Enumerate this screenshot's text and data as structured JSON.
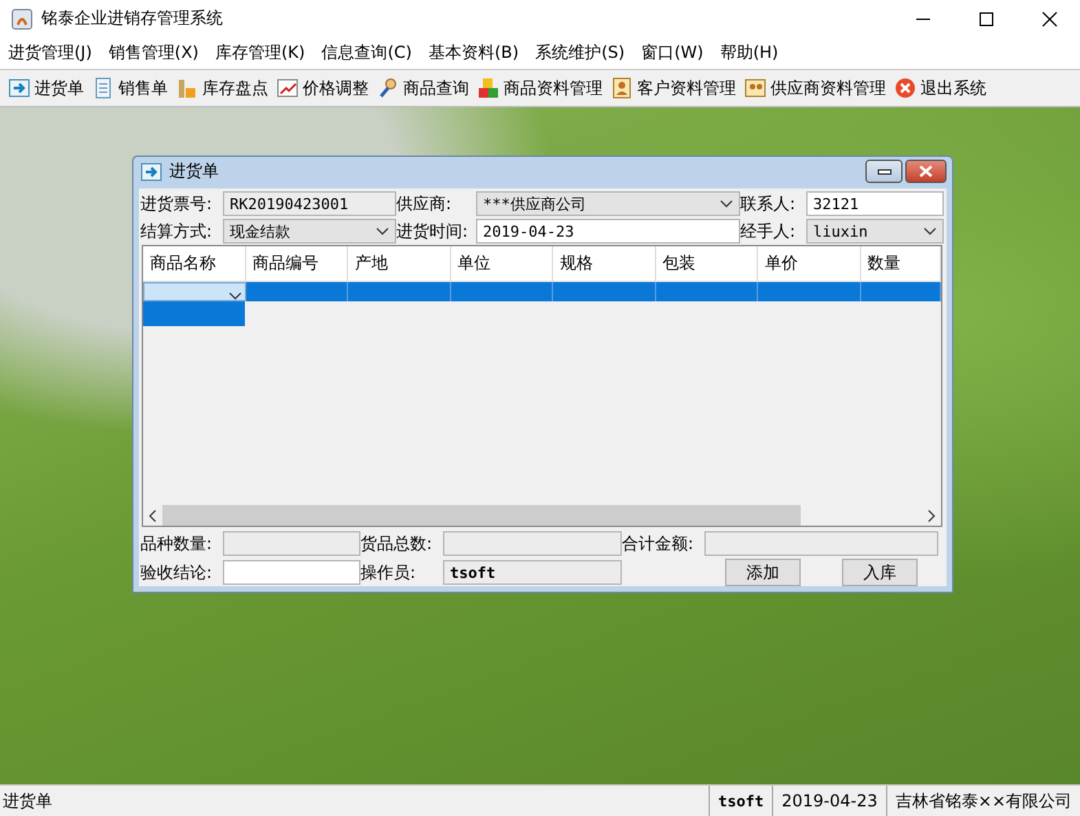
{
  "window": {
    "title": "铭泰企业进销存管理系统"
  },
  "menu": [
    {
      "label": "进货管理(J)"
    },
    {
      "label": "销售管理(X)"
    },
    {
      "label": "库存管理(K)"
    },
    {
      "label": "信息查询(C)"
    },
    {
      "label": "基本资料(B)"
    },
    {
      "label": "系统维护(S)"
    },
    {
      "label": "窗口(W)"
    },
    {
      "label": "帮助(H)"
    }
  ],
  "toolbar": [
    {
      "label": "进货单"
    },
    {
      "label": "销售单"
    },
    {
      "label": "库存盘点"
    },
    {
      "label": "价格调整"
    },
    {
      "label": "商品查询"
    },
    {
      "label": "商品资料管理"
    },
    {
      "label": "客户资料管理"
    },
    {
      "label": "供应商资料管理"
    },
    {
      "label": "退出系统"
    }
  ],
  "dialog": {
    "title": "进货单",
    "fields": [
      {
        "label": "进货票号:",
        "value": "RK20190423001",
        "kind": "readonly"
      },
      {
        "label": "供应商:",
        "value": "***供应商公司",
        "kind": "combo"
      },
      {
        "label": "联系人:",
        "value": "32121",
        "kind": "text"
      },
      {
        "label": "结算方式:",
        "value": "现金结款",
        "kind": "combo"
      },
      {
        "label": "进货时间:",
        "value": "2019-04-23",
        "kind": "text"
      },
      {
        "label": "经手人:",
        "value": "liuxin",
        "kind": "combo"
      }
    ],
    "table": {
      "columns": [
        "商品名称",
        "商品编号",
        "产地",
        "单位",
        "规格",
        "包装",
        "单价",
        "数量"
      ],
      "rows": [
        {
          "selected": true,
          "editing": true,
          "dropdown_open": true
        }
      ]
    },
    "summary": [
      {
        "label": "品种数量:",
        "kind": "readonly"
      },
      {
        "label": "货品总数:",
        "kind": "readonly"
      },
      {
        "label": "合计金额:",
        "kind": "readonly"
      },
      {
        "label": "验收结论:",
        "kind": "text"
      },
      {
        "label": "操作员:",
        "value": "tsoft",
        "kind": "readonly"
      }
    ],
    "buttons": [
      "添加",
      "入库"
    ]
  },
  "status_bar": [
    "进货单",
    "tsoft",
    "2019-04-23",
    "吉林省铭泰××有限公司"
  ]
}
